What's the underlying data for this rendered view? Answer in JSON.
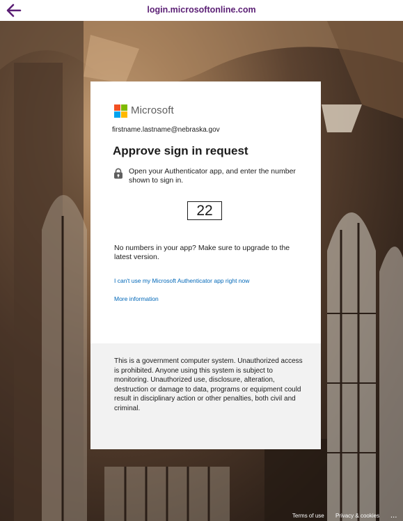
{
  "browser": {
    "url": "login.microsoftonline.com",
    "back_icon": "arrow-left-icon",
    "accent": "#5a1e74"
  },
  "card": {
    "brand": "Microsoft",
    "brand_colors": [
      "#f25022",
      "#7fba00",
      "#00a4ef",
      "#ffb900"
    ],
    "identity": "firstname.lastname@nebraska.gov",
    "title": "Approve sign in request",
    "instruction_icon": "lock-icon",
    "instruction": "Open your Authenticator app, and enter the number shown to sign in.",
    "number": "22",
    "upgrade_text": "No numbers in your app? Make sure to upgrade to the latest version.",
    "links": {
      "cant_use": "I can't use my Microsoft Authenticator app right now",
      "more_info": "More information"
    },
    "link_color": "#0067b8",
    "notice": "This is a government computer system. Unauthorized access is prohibited. Anyone using this system is subject to monitoring. Unauthorized use, disclosure, alteration, destruction or damage to data, programs or equipment could result in disciplinary action or other penalties, both civil and criminal."
  },
  "footer": {
    "terms": "Terms of use",
    "privacy": "Privacy & cookies",
    "more": "..."
  }
}
